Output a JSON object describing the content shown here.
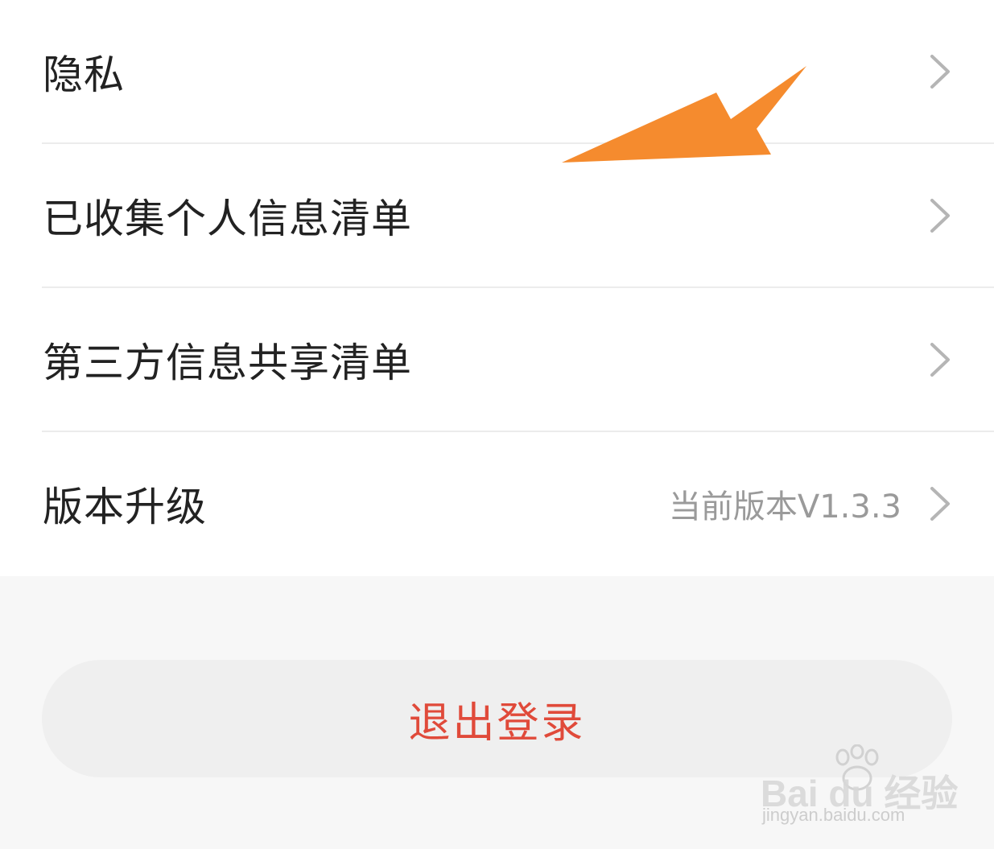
{
  "menu": {
    "items": [
      {
        "label": "隐私",
        "value": ""
      },
      {
        "label": "已收集个人信息清单",
        "value": ""
      },
      {
        "label": "第三方信息共享清单",
        "value": ""
      },
      {
        "label": "版本升级",
        "value": "当前版本V1.3.3"
      }
    ]
  },
  "logout": {
    "label": "退出登录"
  },
  "colors": {
    "logout_text": "#e04a3a",
    "annotation_arrow": "#f58b2e",
    "primary_text": "#222222",
    "secondary_text": "#9a9a9a"
  },
  "icons": {
    "row_chevron": "chevron-right-icon",
    "annotation": "arrow-icon"
  },
  "watermark": {
    "brand": "Bai du 经验",
    "url": "jingyan.baidu.com"
  }
}
